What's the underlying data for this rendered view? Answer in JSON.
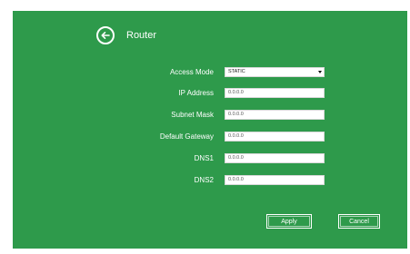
{
  "header": {
    "title": "Router"
  },
  "form": {
    "access_mode": {
      "label": "Access Mode",
      "value": "STATIC"
    },
    "ip_address": {
      "label": "IP Address",
      "value": "0.0.0.0"
    },
    "subnet_mask": {
      "label": "Subnet Mask",
      "value": "0.0.0.0"
    },
    "default_gateway": {
      "label": "Default Gateway",
      "value": "0.0.0.0"
    },
    "dns1": {
      "label": "DNS1",
      "value": "0.0.0.0"
    },
    "dns2": {
      "label": "DNS2",
      "value": "0.0.0.0"
    }
  },
  "buttons": {
    "apply": "Apply",
    "cancel": "Cancel"
  },
  "icons": {
    "back": "back-arrow-icon",
    "dropdown": "chevron-down-icon"
  },
  "colors": {
    "panel": "#2e9a4b",
    "text": "#ffffff"
  }
}
